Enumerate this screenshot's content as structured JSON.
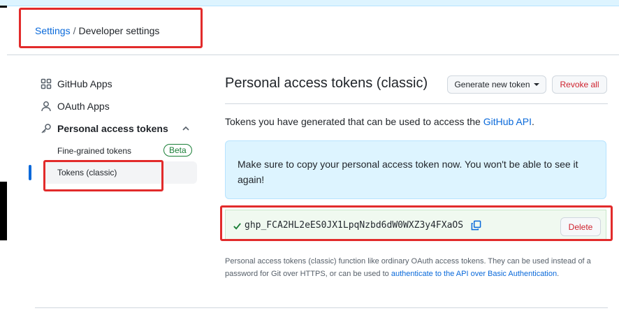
{
  "breadcrumb": {
    "settings": "Settings",
    "separator": "/",
    "current": "Developer settings"
  },
  "sidebar": {
    "items": [
      {
        "label": "GitHub Apps",
        "icon": "apps-icon"
      },
      {
        "label": "OAuth Apps",
        "icon": "person-icon"
      },
      {
        "label": "Personal access tokens",
        "icon": "key-icon"
      }
    ],
    "subitems": [
      {
        "label": "Fine-grained tokens",
        "badge": "Beta"
      },
      {
        "label": "Tokens (classic)"
      }
    ]
  },
  "main": {
    "title": "Personal access tokens (classic)",
    "generate_label": "Generate new token",
    "revoke_label": "Revoke all",
    "description_prefix": "Tokens you have generated that can be used to access the ",
    "description_link": "GitHub API",
    "description_suffix": ".",
    "flash": "Make sure to copy your personal access token now. You won't be able to see it again!",
    "token": "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",
    "delete_label": "Delete",
    "note_prefix": "Personal access tokens (classic) function like ordinary OAuth access tokens. They can be used instead of a password for Git over HTTPS, or can be used to ",
    "note_link": "authenticate to the API over Basic Authentication",
    "note_suffix": "."
  },
  "colors": {
    "accent": "#0969da",
    "danger": "#cf222e",
    "success": "#1a7f37",
    "annotation": "#e22b2b"
  }
}
